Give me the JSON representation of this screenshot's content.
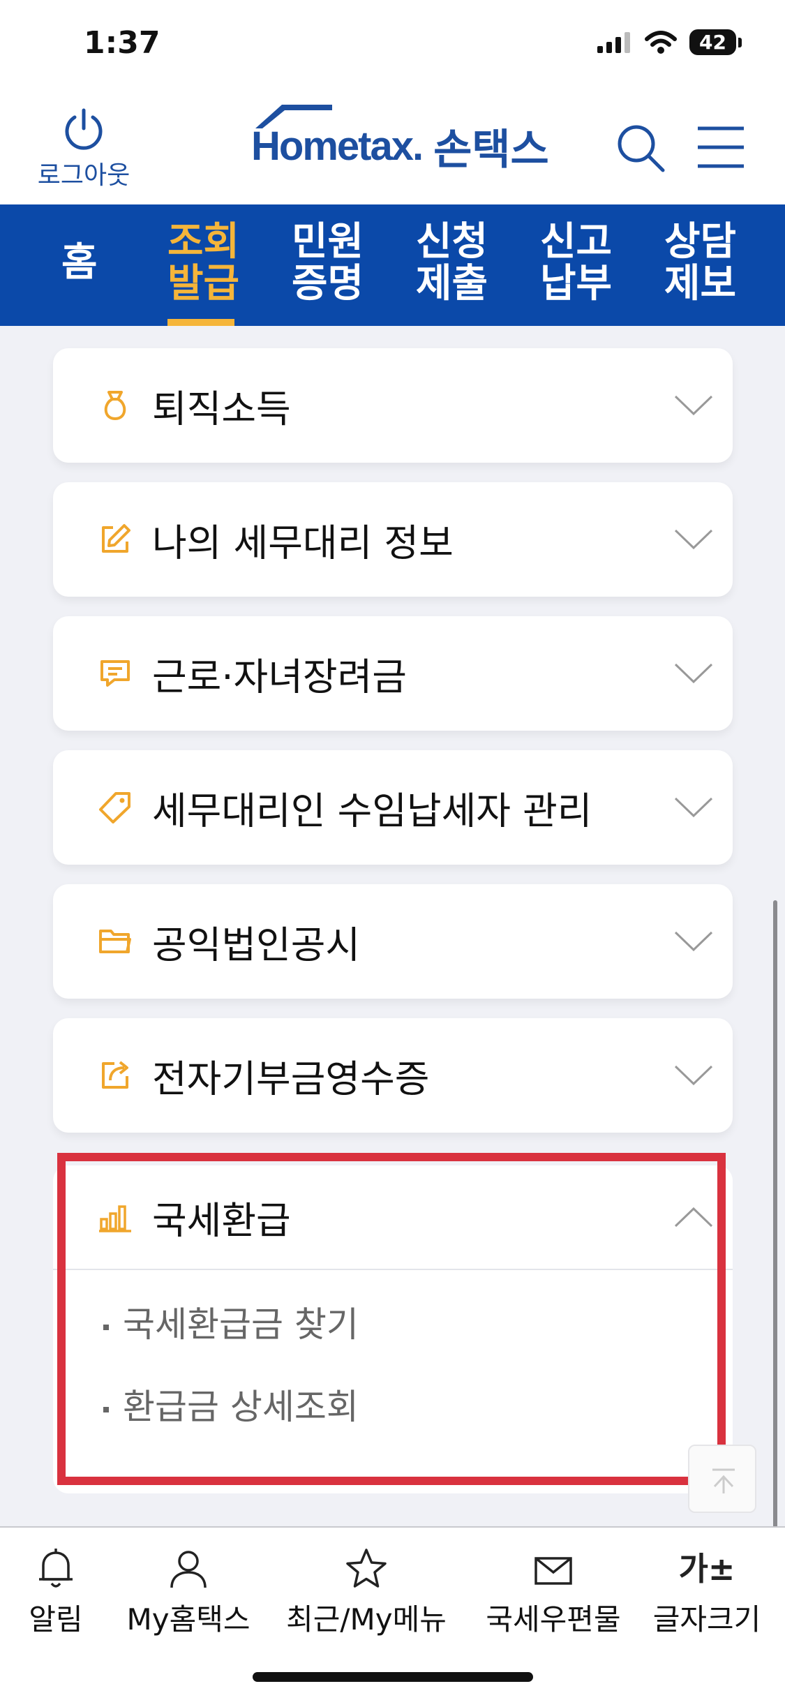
{
  "status_bar": {
    "time": "1:37",
    "battery": "42"
  },
  "header": {
    "logout_label": "로그아웃",
    "logo_en": "Hometax.",
    "logo_ko": "손택스"
  },
  "nav": {
    "tabs": [
      {
        "label": "홈",
        "active": false
      },
      {
        "label": "조회\n발급",
        "active": true
      },
      {
        "label": "민원\n증명",
        "active": false
      },
      {
        "label": "신청\n제출",
        "active": false
      },
      {
        "label": "신고\n납부",
        "active": false
      },
      {
        "label": "상담\n제보",
        "active": false
      }
    ]
  },
  "menu_cards": [
    {
      "label": "퇴직소득",
      "icon": "money-bag-icon"
    },
    {
      "label": "나의 세무대리 정보",
      "icon": "edit-icon"
    },
    {
      "label": "근로·자녀장려금",
      "icon": "message-icon"
    },
    {
      "label": "세무대리인 수임납세자 관리",
      "icon": "tag-icon"
    },
    {
      "label": "공익법인공시",
      "icon": "folder-icon"
    },
    {
      "label": "전자기부금영수증",
      "icon": "share-icon"
    }
  ],
  "expanded_card": {
    "label": "국세환급",
    "icon": "bar-chart-icon",
    "sub_items": [
      {
        "label": "국세환급금 찾기"
      },
      {
        "label": "환급금 상세조회"
      }
    ]
  },
  "tab_bar": {
    "tabs": [
      {
        "label": "알림",
        "icon": "bell-icon"
      },
      {
        "label": "My홈택스",
        "icon": "user-icon"
      },
      {
        "label": "최근/My메뉴",
        "icon": "star-icon"
      },
      {
        "label": "국세우편물",
        "icon": "mail-icon"
      },
      {
        "label": "글자크기",
        "icon": "font-size-icon"
      }
    ],
    "font_size_glyph": "가±"
  },
  "colors": {
    "brand_blue": "#0b49a9",
    "accent_orange": "#f5b53a",
    "icon_orange": "#f0a62c",
    "highlight_red": "#d9323f"
  }
}
